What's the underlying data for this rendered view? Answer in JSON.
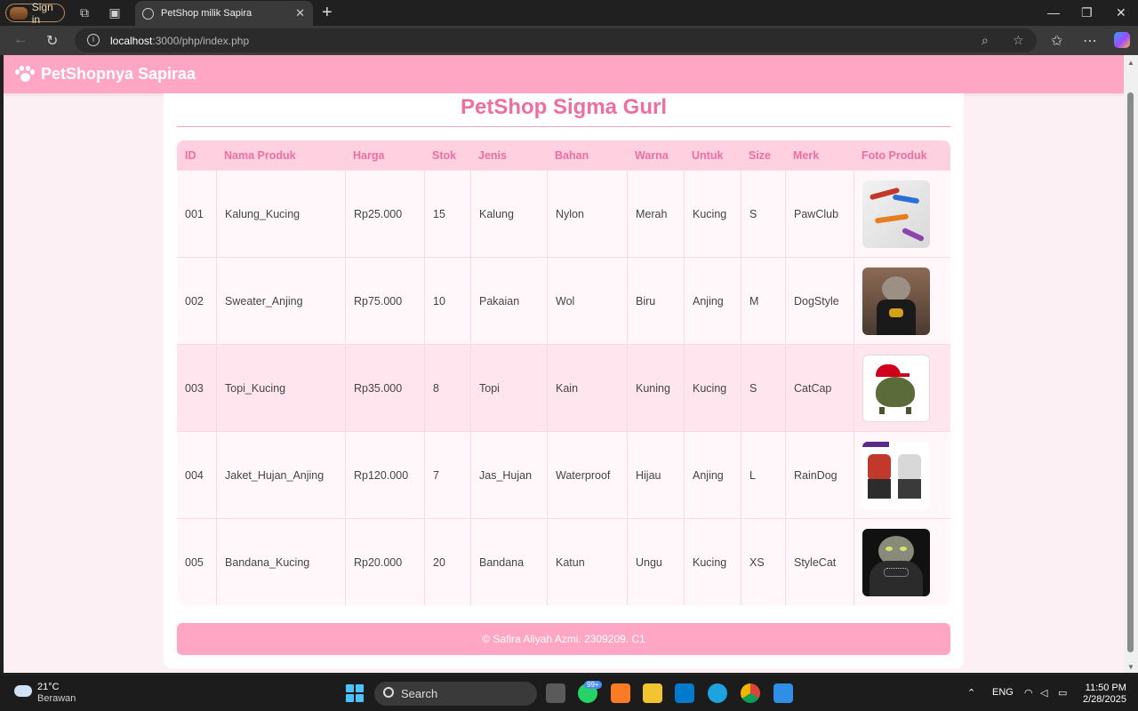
{
  "browser": {
    "profile_label": "Sign in",
    "tab_title": "PetShop milik Sapira",
    "url_host": "localhost",
    "url_path": ":3000/php/index.php"
  },
  "site": {
    "brand": "PetShopnya Sapiraa",
    "page_title": "PetShop Sigma Gurl",
    "footer": "© Safira Aliyah Azmi. 2309209. C1"
  },
  "table": {
    "headers": [
      "ID",
      "Nama Produk",
      "Harga",
      "Stok",
      "Jenis",
      "Bahan",
      "Warna",
      "Untuk",
      "Size",
      "Merk",
      "Foto Produk"
    ],
    "rows": [
      {
        "id": "001",
        "nama": "Kalung_Kucing",
        "harga": "Rp25.000",
        "stok": "15",
        "jenis": "Kalung",
        "bahan": "Nylon",
        "warna": "Merah",
        "untuk": "Kucing",
        "size": "S",
        "merk": "PawClub",
        "foto": "collar-photo"
      },
      {
        "id": "002",
        "nama": "Sweater_Anjing",
        "harga": "Rp75.000",
        "stok": "10",
        "jenis": "Pakaian",
        "bahan": "Wol",
        "warna": "Biru",
        "untuk": "Anjing",
        "size": "M",
        "merk": "DogStyle",
        "foto": "sweater-photo"
      },
      {
        "id": "003",
        "nama": "Topi_Kucing",
        "harga": "Rp35.000",
        "stok": "8",
        "jenis": "Topi",
        "bahan": "Kain",
        "warna": "Kuning",
        "untuk": "Kucing",
        "size": "S",
        "merk": "CatCap",
        "foto": "cap-photo"
      },
      {
        "id": "004",
        "nama": "Jaket_Hujan_Anjing",
        "harga": "Rp120.000",
        "stok": "7",
        "jenis": "Jas_Hujan",
        "bahan": "Waterproof",
        "warna": "Hijau",
        "untuk": "Anjing",
        "size": "L",
        "merk": "RainDog",
        "foto": "jacket-photo"
      },
      {
        "id": "005",
        "nama": "Bandana_Kucing",
        "harga": "Rp20.000",
        "stok": "20",
        "jenis": "Bandana",
        "bahan": "Katun",
        "warna": "Ungu",
        "untuk": "Kucing",
        "size": "XS",
        "merk": "StyleCat",
        "foto": "bandana-photo"
      }
    ]
  },
  "taskbar": {
    "temperature": "21°C",
    "weather": "Berawan",
    "search_label": "Search",
    "notification_badge": "99+",
    "language": "ENG",
    "time": "11:50 PM",
    "date": "2/28/2025"
  },
  "colors": {
    "header_pink": "#ffa6c4",
    "title_pink": "#ef6ea0",
    "table_header": "#ffd1e0"
  }
}
